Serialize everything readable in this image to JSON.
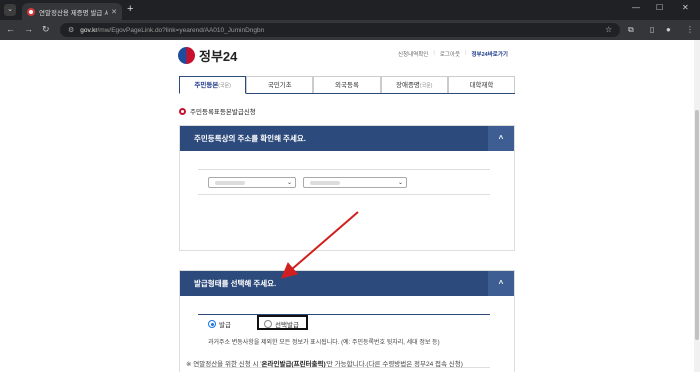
{
  "browser": {
    "tab_title": "연말정산용 제증명 발급 서비스",
    "url_host": "gov.kr",
    "url_path": "/mw/EgovPageLink.do?link=yearend/AA010_JuminDngbn"
  },
  "site": {
    "logo_text": "정부24",
    "links": [
      "신청내역확인",
      "로그아웃",
      "정부24바로가기"
    ]
  },
  "tabs": [
    {
      "label": "주민등본",
      "suffix": "(국문)"
    },
    {
      "label": "국민기초",
      "suffix": ""
    },
    {
      "label": "외국등록",
      "suffix": ""
    },
    {
      "label": "장애증명",
      "suffix": "(국문)"
    },
    {
      "label": "대학재학",
      "suffix": ""
    }
  ],
  "section_title": "주민등록표등본발급신청",
  "address_panel": {
    "heading": "주민등록상의 주소를 확인해 주세요.",
    "collapse_glyph": "^"
  },
  "issue_panel": {
    "heading": "발급형태를 선택해 주세요.",
    "collapse_glyph": "^",
    "options": [
      "발급",
      "선택발급"
    ],
    "selected": "발급",
    "description": "과거주소 변동사항을 제외한 모든 정보가 표시됩니다. (예: 주민등록번호 뒷자리, 세대 정보 등)"
  },
  "notice": {
    "prefix": "※ 연말정산을 위한 신청 시 '",
    "bold": "온라인발급(프린터출력)",
    "suffix": "'만 가능합니다.(다른 수령방법은 정부24 접속 신청)"
  },
  "colors": {
    "header_navy": "#2c4a7b",
    "accent_red": "#c8102e",
    "annotation_arrow": "#d11f1f"
  }
}
